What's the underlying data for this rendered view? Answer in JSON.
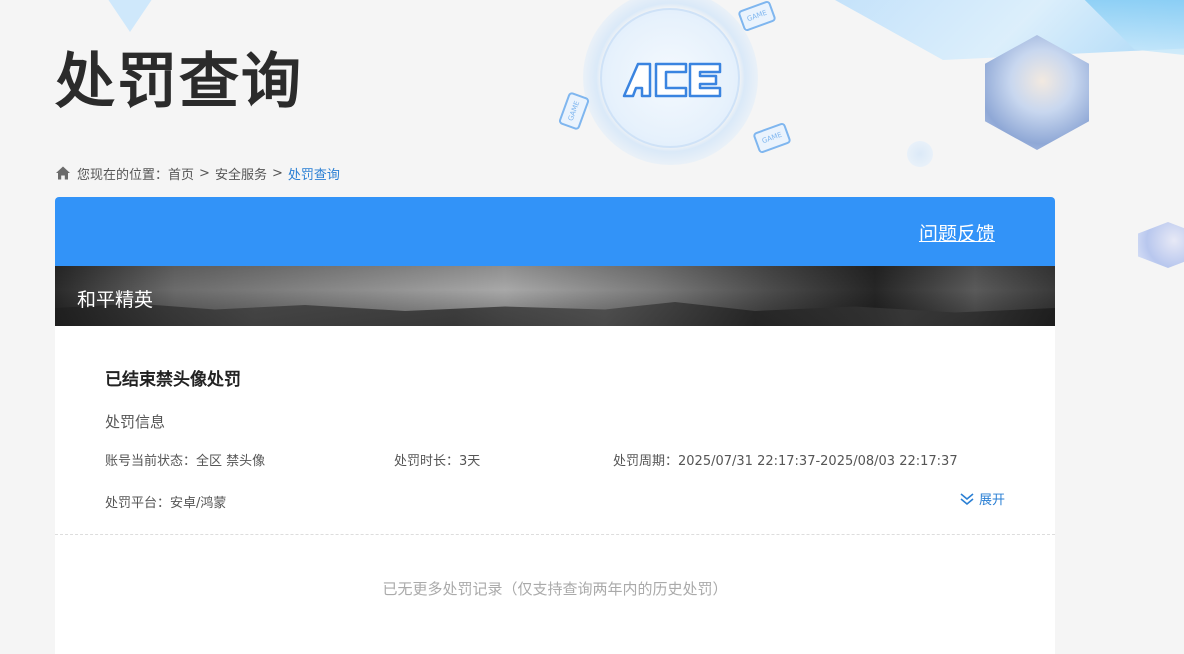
{
  "page": {
    "title": "处罚查询"
  },
  "branding": {
    "logo_text": "ACE",
    "game_tag": "GAME"
  },
  "breadcrumb": {
    "prefix": "您现在的位置：",
    "items": [
      "首页",
      "安全服务",
      "处罚查询"
    ],
    "separator": ">"
  },
  "header": {
    "feedback_label": "问题反馈",
    "accent_color": "#3293f8"
  },
  "game": {
    "name": "和平精英"
  },
  "record": {
    "title": "已结束禁头像处罚",
    "section_label": "处罚信息",
    "status_label": "账号当前状态：",
    "status_value": "全区 禁头像",
    "duration_label": "处罚时长：",
    "duration_value": "3天",
    "period_label": "处罚周期：",
    "period_value": "2025/07/31 22:17:37-2025/08/03 22:17:37",
    "platform_label": "处罚平台：",
    "platform_value": "安卓/鸿蒙",
    "expand_label": "展开"
  },
  "footer": {
    "no_more_text": "已无更多处罚记录（仅支持查询两年内的历史处罚）"
  }
}
